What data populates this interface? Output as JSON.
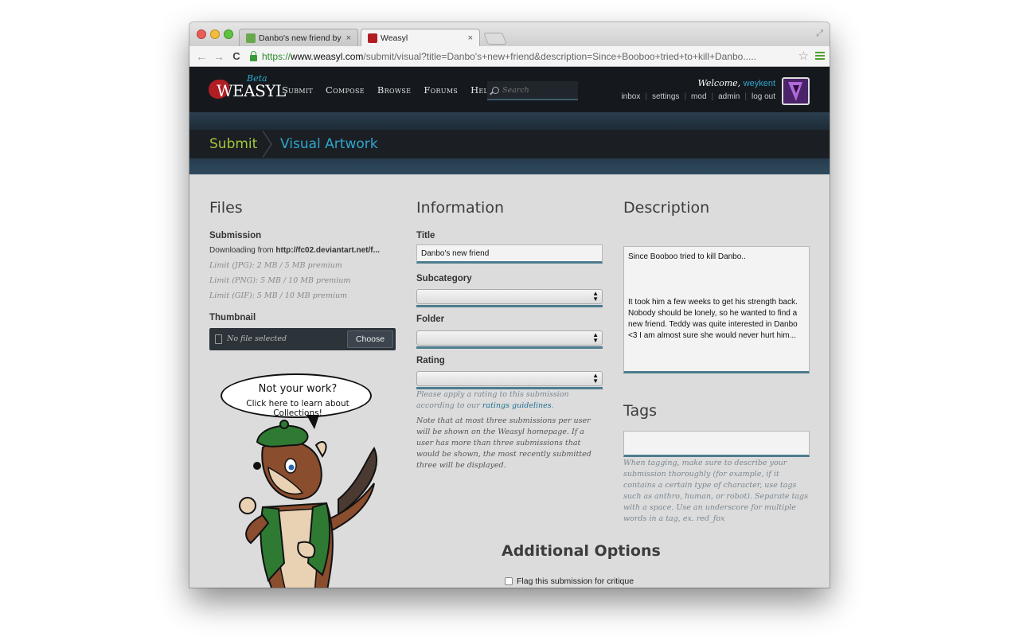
{
  "browser": {
    "tabs": [
      {
        "title": "Danbo's new friend by =li",
        "favicon_color": "#6aa84f",
        "close": "×"
      },
      {
        "title": "Weasyl",
        "favicon_color": "#b01e23",
        "close": "×"
      }
    ],
    "nav": {
      "back": "←",
      "forward": "→",
      "reload": "C"
    },
    "url": {
      "scheme": "https://",
      "host": "www.weasyl.com",
      "path": "/submit/visual?title=Danbo's+new+friend&description=Since+Booboo+tried+to+kill+Danbo....."
    },
    "star": "☆",
    "resize": "⤢"
  },
  "site": {
    "logo": {
      "text": "WEASYL",
      "beta": "Beta"
    },
    "nav": [
      "Submit",
      "Compose",
      "Browse",
      "Forums",
      "Help"
    ],
    "search_placeholder": "Search",
    "welcome_prefix": "Welcome,",
    "username": "weykent",
    "user_links": [
      "inbox",
      "settings",
      "mod",
      "admin",
      "log out"
    ]
  },
  "breadcrumb": {
    "first": "Submit",
    "second": "Visual Artwork"
  },
  "files": {
    "heading": "Files",
    "submission_label": "Submission",
    "downloading_prefix": "Downloading from ",
    "downloading_url": "http://fc02.deviantart.net/f...",
    "limits": [
      "Limit (JPG): 2 MB / 5 MB premium",
      "Limit (PNG): 5 MB / 10 MB premium",
      "Limit (GIF): 5 MB / 10 MB premium"
    ],
    "thumbnail_label": "Thumbnail",
    "thumbnail_status": "No file selected",
    "choose_button": "Choose",
    "mascot_line1": "Not your work?",
    "mascot_line2": "Click here to learn about Collections!"
  },
  "information": {
    "heading": "Information",
    "title_label": "Title",
    "title_value": "Danbo's new friend",
    "subcategory_label": "Subcategory",
    "folder_label": "Folder",
    "rating_label": "Rating",
    "rating_note_prefix": "Please apply a rating to this submission according to our ",
    "rating_note_link": "ratings guidelines",
    "rating_note_suffix": ".",
    "homepage_note": "Note that at most three submissions per user will be shown on the Weasyl homepage. If a user has more than three submissions that would be shown, the most recently submitted three will be displayed."
  },
  "description": {
    "heading": "Description",
    "value": "Since Booboo tried to kill Danbo..\n\n\n\nIt took him a few weeks to get his strength back.\nNobody should be lonely, so he wanted to find a new friend. Teddy was quite interested in Danbo <3 I am almost sure she would never hurt him..."
  },
  "tags": {
    "heading": "Tags",
    "value": "",
    "note": "When tagging, make sure to describe your submission thoroughly (for example, if it contains a certain type of character, use tags such as anthro, human, or robot). Separate tags with a space. Use an underscore for multiple words in a tag, ex. red_fox"
  },
  "additional": {
    "heading": "Additional Options",
    "critique_label": "Flag this submission for critique",
    "critique_checked": false
  }
}
